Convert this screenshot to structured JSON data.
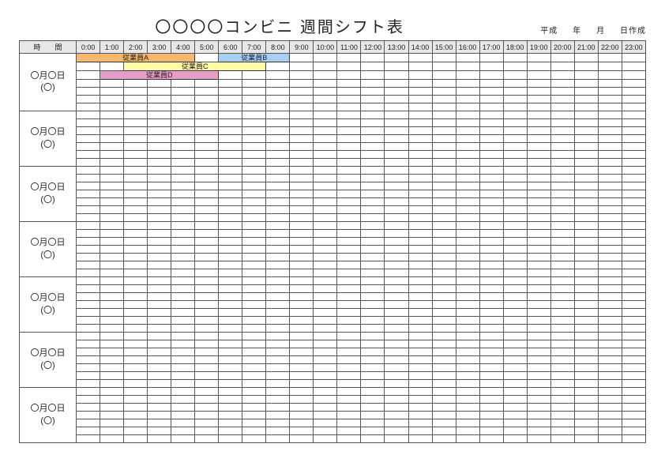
{
  "title": "〇〇〇〇コンビニ 週間シフト表",
  "meta": {
    "era": "平成",
    "year_suffix": "年",
    "month_suffix": "月",
    "day_suffix": "日作成"
  },
  "header": {
    "label": "時　　間",
    "hours": [
      "0:00",
      "1:00",
      "2:00",
      "3:00",
      "4:00",
      "5:00",
      "6:00",
      "7:00",
      "8:00",
      "9:00",
      "10:00",
      "11:00",
      "12:00",
      "13:00",
      "14:00",
      "15:00",
      "16:00",
      "17:00",
      "18:00",
      "19:00",
      "20:00",
      "21:00",
      "22:00",
      "23:00"
    ]
  },
  "days": [
    {
      "label_line1": "〇月〇日",
      "label_line2": "(〇)"
    },
    {
      "label_line1": "〇月〇日",
      "label_line2": "(〇)"
    },
    {
      "label_line1": "〇月〇日",
      "label_line2": "(〇)"
    },
    {
      "label_line1": "〇月〇日",
      "label_line2": "(〇)"
    },
    {
      "label_line1": "〇月〇日",
      "label_line2": "(〇)"
    },
    {
      "label_line1": "〇月〇日",
      "label_line2": "(〇)"
    },
    {
      "label_line1": "〇月〇日",
      "label_line2": "(〇)"
    }
  ],
  "bars": [
    {
      "day": 0,
      "row": 0,
      "start": 0,
      "span": 5,
      "label": "従業員A",
      "bg": "#f4b96f"
    },
    {
      "day": 0,
      "row": 0,
      "start": 6,
      "span": 3,
      "label": "従業員B",
      "bg": "#a9cef4"
    },
    {
      "day": 0,
      "row": 1,
      "start": 2,
      "span": 6,
      "label": "従業員C",
      "bg": "#fff9a8"
    },
    {
      "day": 0,
      "row": 2,
      "start": 1,
      "span": 5,
      "label": "従業員D",
      "bg": "#e49ec8"
    }
  ],
  "rows_per_day": 7,
  "hours_count": 24
}
